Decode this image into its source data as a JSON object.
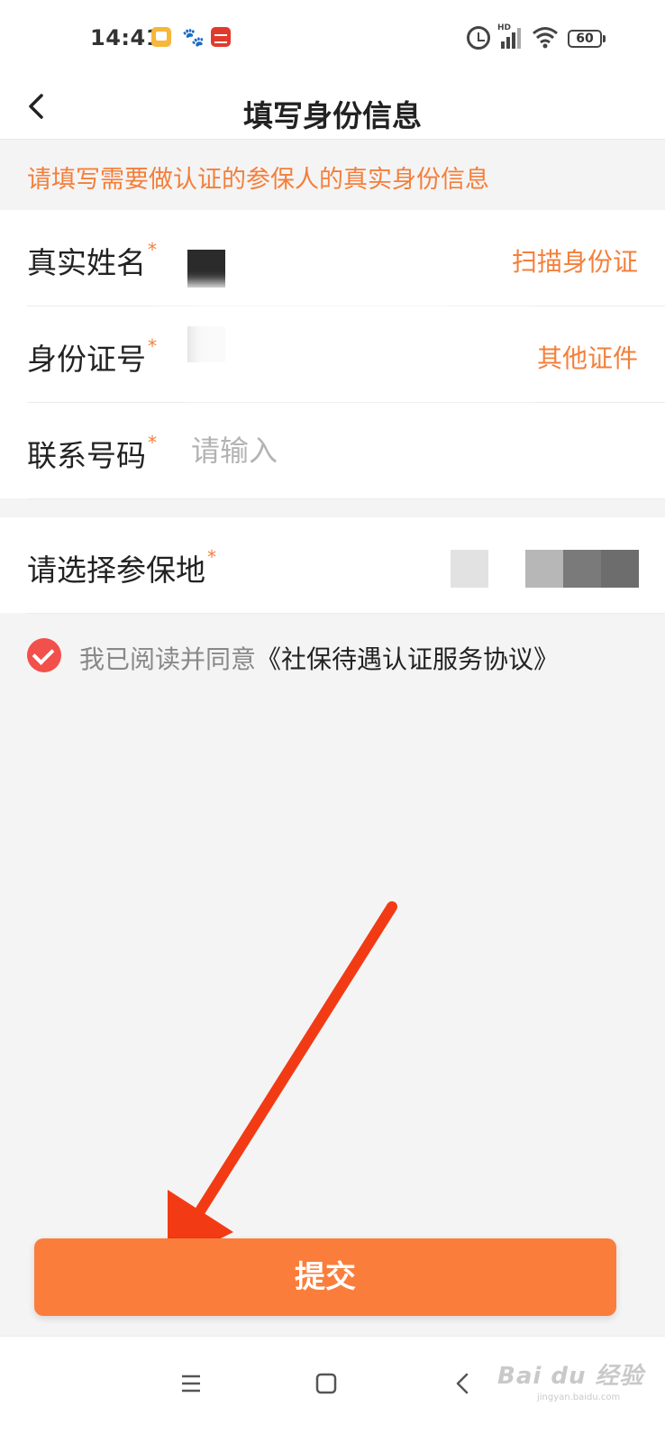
{
  "status_bar": {
    "time": "14:41",
    "battery": "60",
    "signal_label": "HD"
  },
  "header": {
    "title": "填写身份信息"
  },
  "notice": "请填写需要做认证的参保人的真实身份信息",
  "form": {
    "rows": [
      {
        "label": "真实姓名",
        "required_mark": "*",
        "action": "扫描身份证"
      },
      {
        "label": "身份证号",
        "required_mark": "*",
        "action": "其他证件"
      },
      {
        "label": "联系号码",
        "required_mark": "*",
        "placeholder": "请输入"
      }
    ]
  },
  "location": {
    "label": "请选择参保地",
    "required_mark": "*"
  },
  "agreement": {
    "prefix": "我已阅读并同意",
    "link": "《社保待遇认证服务协议》",
    "checked": true
  },
  "submit_label": "提交",
  "watermark": {
    "main": "Bai du 经验",
    "sub": "jingyan.baidu.com"
  },
  "colors": {
    "accent": "#f47f3a",
    "submit": "#fb7d3b",
    "check": "#f2504b",
    "arrow": "#f23b14"
  },
  "icons": [
    "back-arrow-icon",
    "alarm-icon",
    "signal-icon",
    "wifi-icon",
    "battery-icon",
    "check-icon",
    "menu-icon",
    "home-icon",
    "nav-back-icon"
  ]
}
